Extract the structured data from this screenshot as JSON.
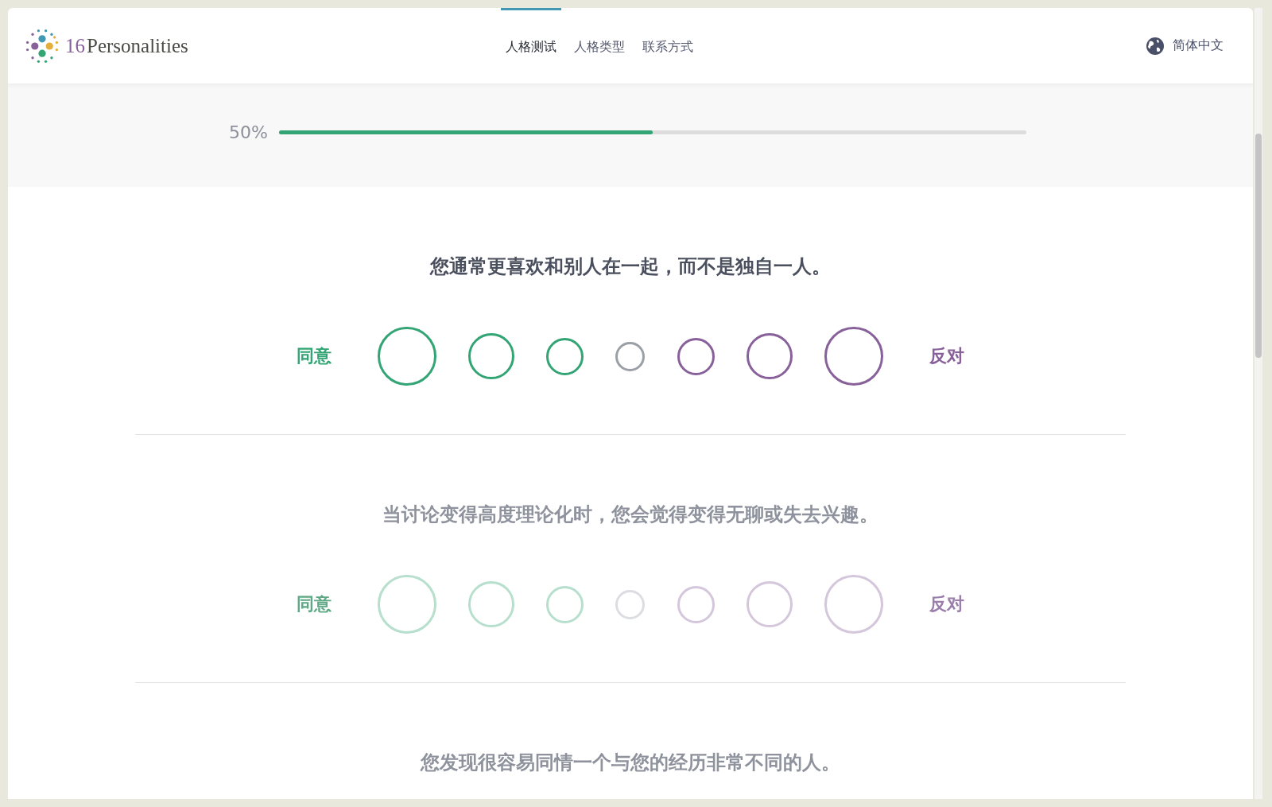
{
  "header": {
    "logo": {
      "number": "16",
      "word": "Personalities"
    },
    "nav": [
      {
        "label": "人格测试",
        "selected": true
      },
      {
        "label": "人格类型",
        "selected": false
      },
      {
        "label": "联系方式",
        "selected": false
      }
    ],
    "language": "简体中文"
  },
  "progress": {
    "reading": "50%",
    "level": 0.5
  },
  "questions": [
    {
      "text": "您通常更喜欢和别人在一起，而不是独自一人。",
      "active": true,
      "agree_label": "同意",
      "disagree_label": "反对",
      "options": [
        {
          "selected": false
        },
        {
          "selected": false
        },
        {
          "selected": false
        },
        {
          "selected": false
        },
        {
          "selected": false
        },
        {
          "selected": false
        },
        {
          "selected": false
        }
      ]
    },
    {
      "text": "当讨论变得高度理论化时，您会觉得变得无聊或失去兴趣。",
      "active": false,
      "agree_label": "同意",
      "disagree_label": "反对",
      "options": [
        {
          "selected": false
        },
        {
          "selected": false
        },
        {
          "selected": false
        },
        {
          "selected": false
        },
        {
          "selected": false
        },
        {
          "selected": false
        },
        {
          "selected": false
        }
      ]
    },
    {
      "text": "您发现很容易同情一个与您的经历非常不同的人。",
      "active": false
    }
  ]
}
